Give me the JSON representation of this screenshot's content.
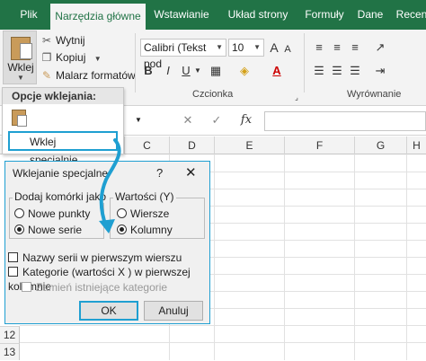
{
  "tabs": [
    "Plik",
    "Narzędzia główne",
    "Wstawianie",
    "Układ strony",
    "Formuły",
    "Dane",
    "Recen"
  ],
  "active_tab": "Narzędzia główne",
  "clipboard": {
    "paste_label": "Wklej",
    "cut_label": "Wytnij",
    "copy_label": "Kopiuj",
    "format_painter_label": "Malarz formatów"
  },
  "font": {
    "font_name": "Calibri (Tekst pod",
    "font_size": "10",
    "group_label": "Czcionka",
    "bold": "B",
    "italic": "I",
    "underline": "U"
  },
  "alignment": {
    "group_label": "Wyrównanie"
  },
  "formula_bar": {
    "fx": "fx"
  },
  "columns": [
    "C",
    "D",
    "E",
    "F",
    "G",
    "H"
  ],
  "rows": [
    "12",
    "13"
  ],
  "paste_menu": {
    "header": "Opcje wklejania:",
    "paste_special": "Wklej specjalnie..."
  },
  "dialog": {
    "title": "Wklejanie specjalne",
    "help": "?",
    "close": "✕",
    "add_cells_legend": "Dodaj komórki jako",
    "new_points": "Nowe punkty",
    "new_series": "Nowe serie",
    "values_legend": "Wartości (Y)",
    "rows": "Wiersze",
    "columns": "Kolumny",
    "series_names_first_row": "Nazwy serii w pierwszym wierszu",
    "categories_first_column": "Kategorie (wartości X ) w pierwszej kolumnie",
    "replace_categories": "Zamień istniejące kategorie",
    "ok": "OK",
    "cancel": "Anuluj"
  },
  "accent_color": "#217346",
  "highlight_color": "#1f9fd1"
}
